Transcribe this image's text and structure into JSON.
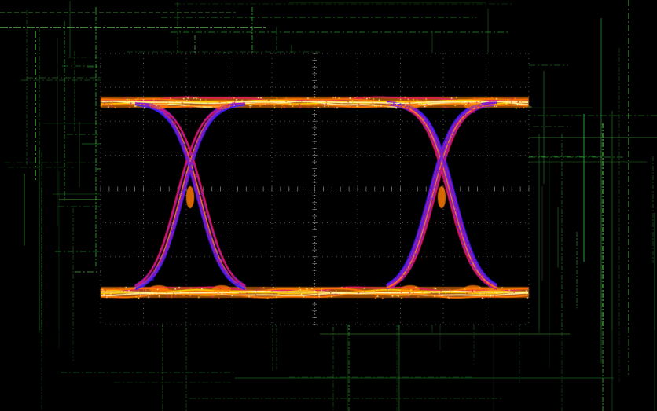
{
  "display": {
    "background_color": "#000000",
    "frame_grid_color": "#2fbf3a",
    "frame_grid_bright_color": "#7dff6a",
    "graticule_color": "#8a8a8a",
    "graticule_divisions": {
      "horizontal": 10,
      "vertical": 8
    },
    "screen_background": "#000000"
  },
  "eye_diagram": {
    "trace_palette": [
      "#3a1cff",
      "#8a1cc8",
      "#e0185a",
      "#ff7a00",
      "#ffd000",
      "#fff2a0"
    ],
    "unit_intervals_shown": 1.5,
    "crossing_count": 2,
    "crossing_level_fraction": 0.5,
    "levels": [
      "high",
      "low"
    ]
  }
}
